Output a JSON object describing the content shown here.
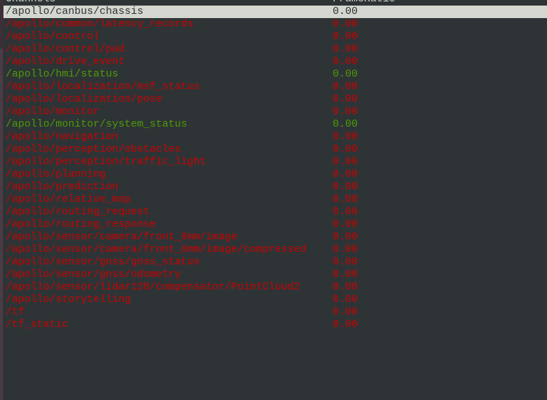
{
  "header": {
    "col1": "Channels",
    "col2": "FrameRatio"
  },
  "colors": {
    "background": "#2e3436",
    "inactive": "#cc0000",
    "active": "#4e9a06",
    "selected_bg": "#d3d7cf"
  },
  "rows": [
    {
      "channel": "/apollo/canbus/chassis",
      "ratio": "0.00",
      "state": "selected"
    },
    {
      "channel": "/apollo/common/latency_records",
      "ratio": "0.00",
      "state": "red"
    },
    {
      "channel": "/apollo/control",
      "ratio": "0.00",
      "state": "red"
    },
    {
      "channel": "/apollo/control/pad",
      "ratio": "0.00",
      "state": "red"
    },
    {
      "channel": "/apollo/drive_event",
      "ratio": "0.00",
      "state": "red"
    },
    {
      "channel": "/apollo/hmi/status",
      "ratio": "0.00",
      "state": "green"
    },
    {
      "channel": "/apollo/localization/msf_status",
      "ratio": "0.00",
      "state": "red"
    },
    {
      "channel": "/apollo/localization/pose",
      "ratio": "0.00",
      "state": "red"
    },
    {
      "channel": "/apollo/monitor",
      "ratio": "0.00",
      "state": "red"
    },
    {
      "channel": "/apollo/monitor/system_status",
      "ratio": "0.00",
      "state": "green"
    },
    {
      "channel": "/apollo/navigation",
      "ratio": "0.00",
      "state": "red"
    },
    {
      "channel": "/apollo/perception/obstacles",
      "ratio": "0.00",
      "state": "red"
    },
    {
      "channel": "/apollo/perception/traffic_light",
      "ratio": "0.00",
      "state": "red"
    },
    {
      "channel": "/apollo/planning",
      "ratio": "0.00",
      "state": "red"
    },
    {
      "channel": "/apollo/prediction",
      "ratio": "0.00",
      "state": "red"
    },
    {
      "channel": "/apollo/relative_map",
      "ratio": "0.00",
      "state": "red"
    },
    {
      "channel": "/apollo/routing_request",
      "ratio": "0.00",
      "state": "red"
    },
    {
      "channel": "/apollo/routing_response",
      "ratio": "0.00",
      "state": "red"
    },
    {
      "channel": "/apollo/sensor/camera/front_6mm/image",
      "ratio": "0.00",
      "state": "red"
    },
    {
      "channel": "/apollo/sensor/camera/front_6mm/image/compressed",
      "ratio": "0.00",
      "state": "red"
    },
    {
      "channel": "/apollo/sensor/gnss/gnss_status",
      "ratio": "0.00",
      "state": "red"
    },
    {
      "channel": "/apollo/sensor/gnss/odometry",
      "ratio": "0.00",
      "state": "red"
    },
    {
      "channel": "/apollo/sensor/lidar128/compensator/PointCloud2",
      "ratio": "0.00",
      "state": "red"
    },
    {
      "channel": "/apollo/storytelling",
      "ratio": "0.00",
      "state": "red"
    },
    {
      "channel": "/tf",
      "ratio": "0.00",
      "state": "red"
    },
    {
      "channel": "/tf_static",
      "ratio": "0.00",
      "state": "red"
    }
  ]
}
